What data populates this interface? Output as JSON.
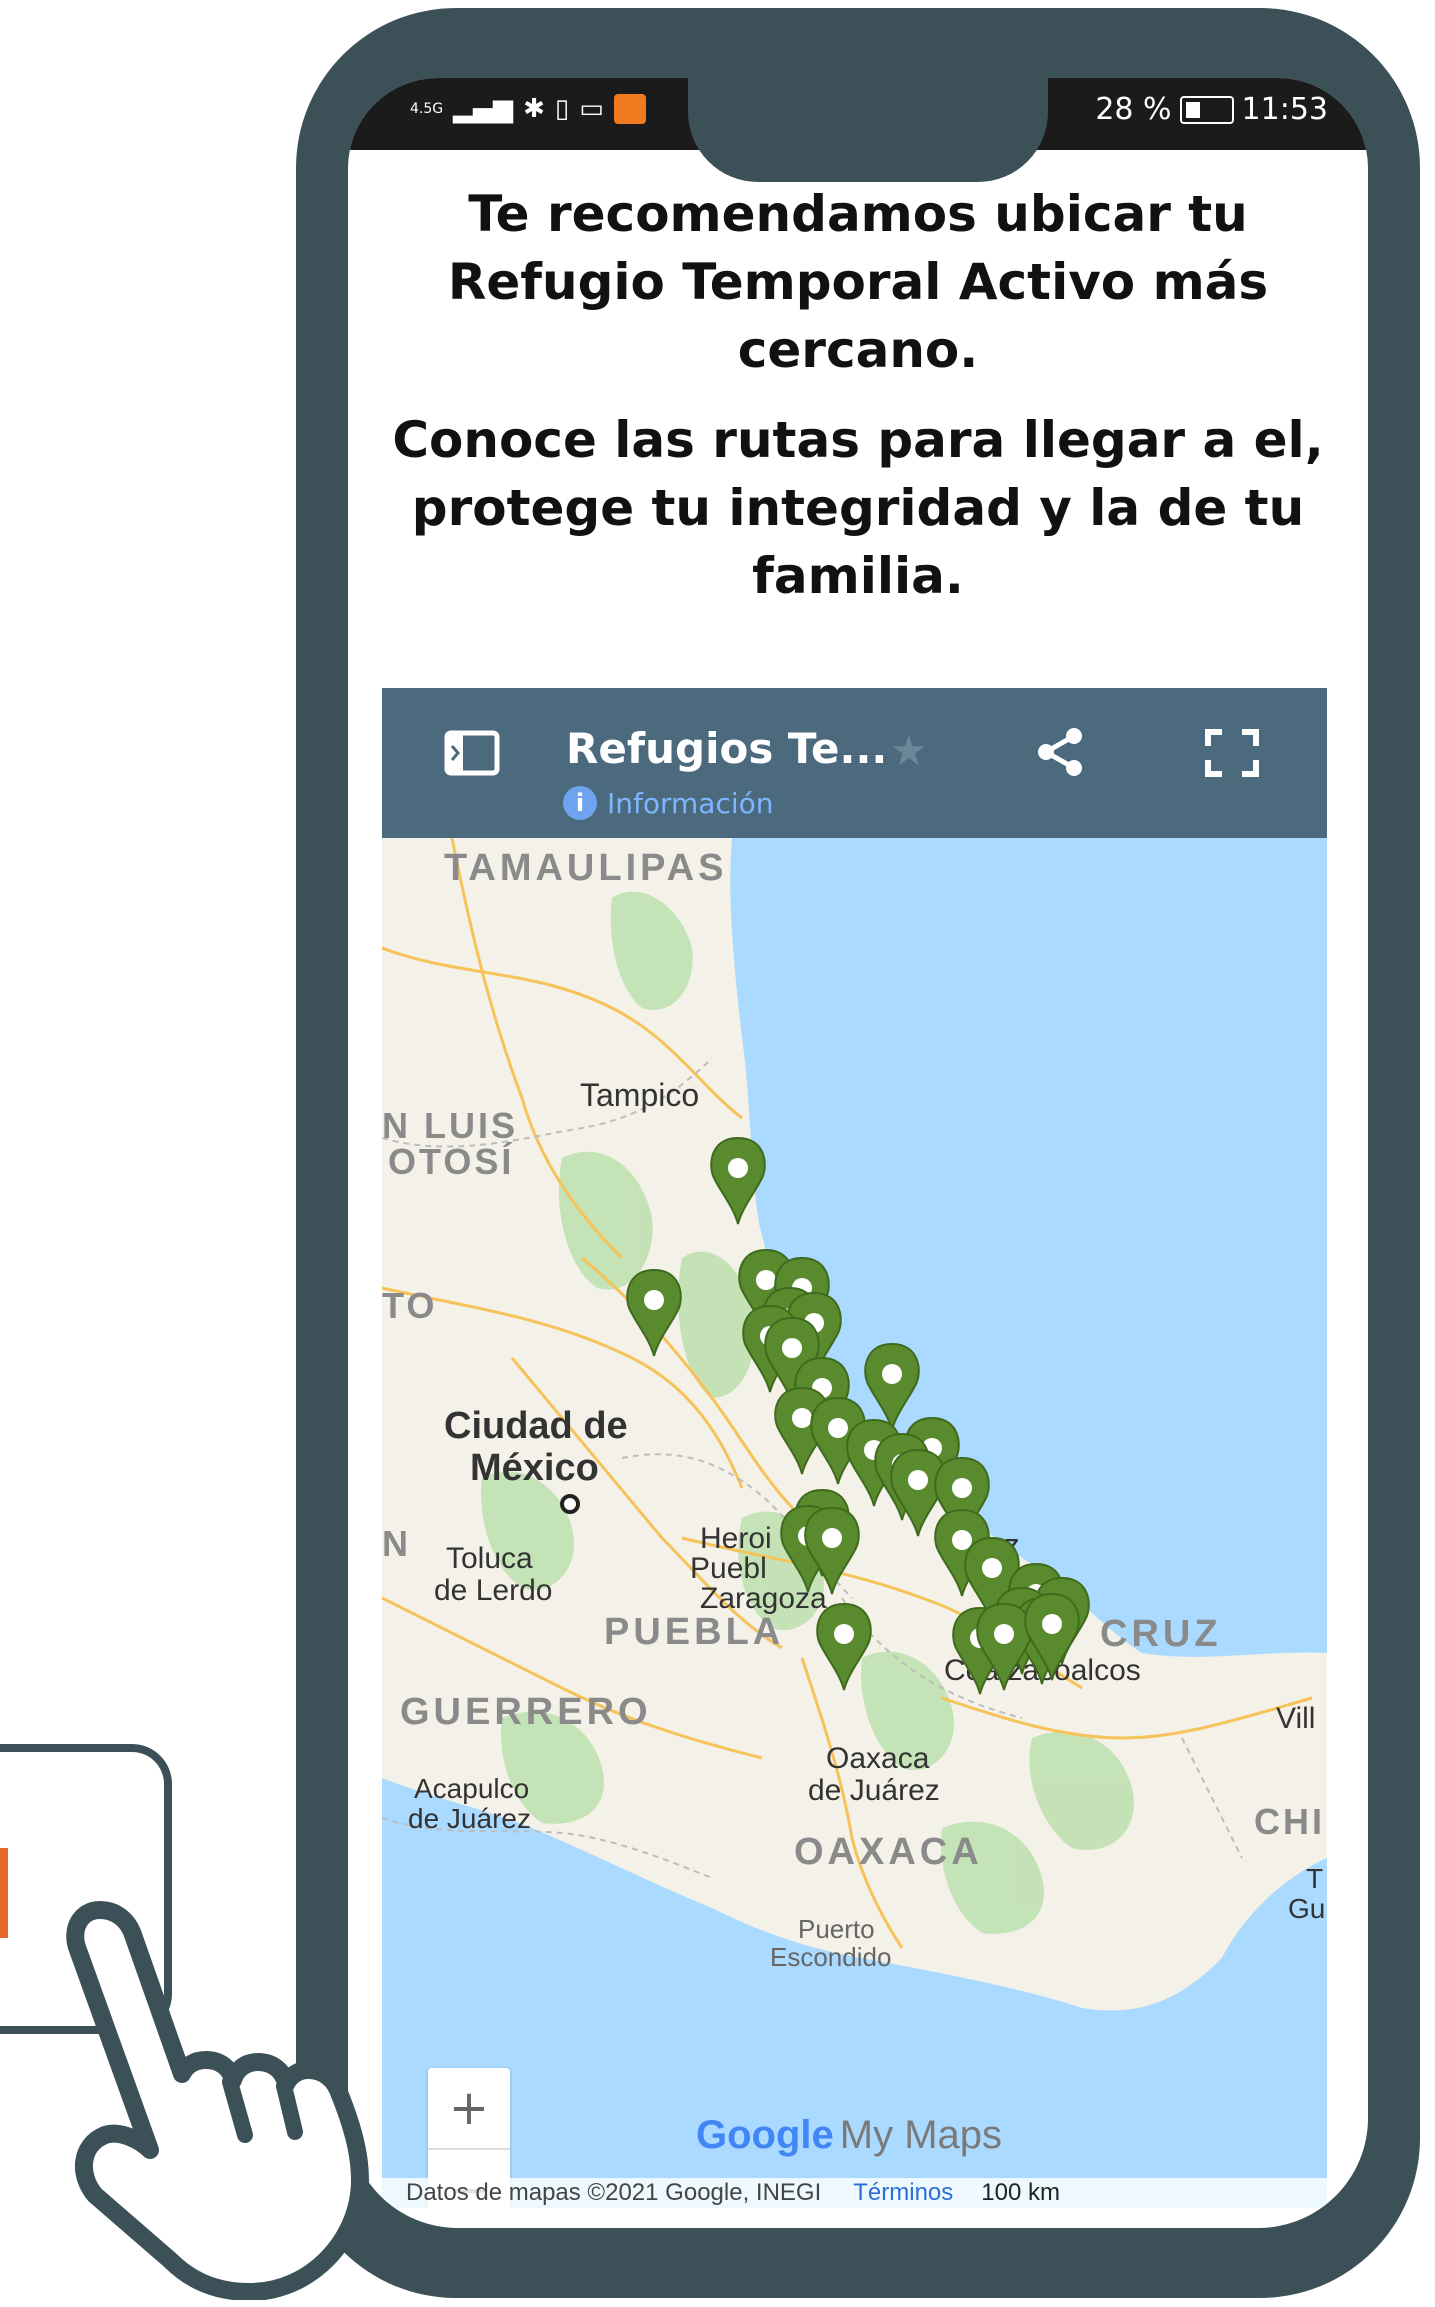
{
  "status_bar": {
    "network": "4.5G",
    "battery": "28 %",
    "time": "11:53"
  },
  "headline": {
    "line1": "Te recomendamos ubicar tu Refugio Temporal Activo más cercano.",
    "line2": "Conoce las rutas para llegar a el, protege tu integridad y la de tu familia."
  },
  "map": {
    "title": "Refugios Te...",
    "info_label": "Información",
    "zoom_in": "+",
    "zoom_out": "−",
    "logo_google": "Google",
    "logo_mymaps": "My Maps",
    "attribution": "Datos de mapas ©2021 Google, INEGI",
    "terms": "Términos",
    "scale": "100 km",
    "labels": {
      "tamaulipas": "TAMAULIPAS",
      "tampico": "Tampico",
      "san_luis_1": "N LUIS",
      "san_luis_2": "OTOSÍ",
      "ato": "TO",
      "cdmx_1": "Ciudad de",
      "cdmx_2": "México",
      "toluca_1": "Toluca",
      "toluca_2": "de Lerdo",
      "n_left": "N",
      "heroica": "Heroi",
      "puebla_city": "Puebl",
      "zaragoza": "Zaragoza",
      "puebla": "PUEBLA",
      "veracruz": "CRUZ",
      "uz": "uz",
      "coatzacoalcos": "Coatzacoalcos",
      "guerrero": "GUERRERO",
      "oaxaca_city_1": "Oaxaca",
      "oaxaca_city_2": "de Juárez",
      "acapulco_1": "Acapulco",
      "acapulco_2": "de Juárez",
      "oaxaca": "OAXACA",
      "chiapas": "CHI",
      "villa": "Vill",
      "puerto_1": "Puerto",
      "puerto_2": "Escondido",
      "gu_1": "T",
      "gu_2": "Gu"
    }
  },
  "colors": {
    "frame": "#3c5057",
    "map_header": "#4b6a7e",
    "marker": "#5a8a2e",
    "water": "#aadaff",
    "land": "#f4f1e8",
    "accent": "#e8672b"
  },
  "icons": [
    "panel-toggle-icon",
    "info-icon",
    "star-icon",
    "share-icon",
    "fullscreen-icon",
    "map-marker-icon",
    "hand-pointer-icon",
    "signal-icon",
    "bluetooth-icon",
    "vibrate-icon",
    "cast-icon",
    "battery-icon"
  ]
}
